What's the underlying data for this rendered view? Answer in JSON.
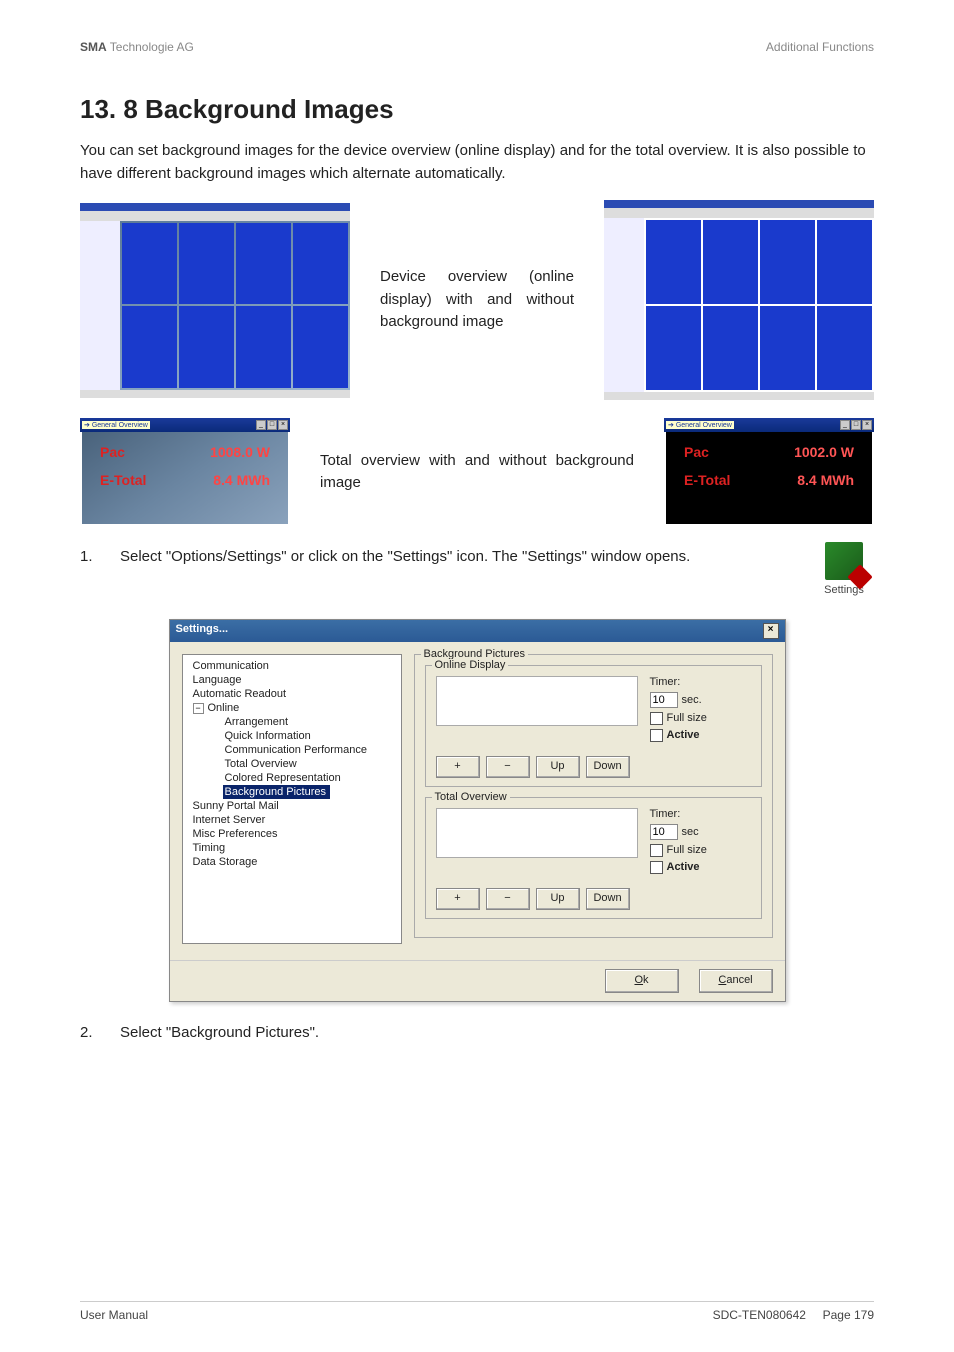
{
  "header": {
    "left_bold": "SMA",
    "left_rest": " Technologie AG",
    "right": "Additional Functions"
  },
  "title": "13. 8 Background Images",
  "intro": "You can set background images for the device overview (online display) and for the total overview. It is also possible to have different background images which alternate automatically.",
  "caption1": "Device overview (online display) with and without background image",
  "caption2": "Total overview with and without background image",
  "overview_window": {
    "title": "General Overview",
    "row1_key": "Pac",
    "row1_val_bg": "1008.0 W",
    "row1_val_nobg": "1002.0 W",
    "row2_key": "E-Total",
    "row2_val": "8.4 MWh"
  },
  "step1_num": "1.",
  "step1_text": "Select \"Options/Settings\" or click on the \"Settings\" icon. The \"Settings\" window opens.",
  "settings_icon_label": "Settings",
  "step2_num": "2.",
  "step2_text": "Select \"Background Pictures\".",
  "settings": {
    "title": "Settings...",
    "tree": {
      "n0": "Communication",
      "n1": "Language",
      "n2": "Automatic Readout",
      "n3": "Online",
      "n3a": "Arrangement",
      "n3b": "Quick Information",
      "n3c": "Communication Performance",
      "n3d": "Total Overview",
      "n3e": "Colored Representation",
      "n3f": "Background Pictures",
      "n4": "Sunny Portal Mail",
      "n5": "Internet Server",
      "n6": "Misc Preferences",
      "n7": "Timing",
      "n8": "Data Storage"
    },
    "group_main": "Background Pictures",
    "group_online": "Online Display",
    "group_total": "Total Overview",
    "btn_plus": "+",
    "btn_minus": "−",
    "btn_up": "Up",
    "btn_down": "Down",
    "timer_label": "Timer:",
    "timer_value_online": "10",
    "timer_unit_online": "sec.",
    "timer_value_total": "10",
    "timer_unit_total": "sec",
    "fullsize": "Full size",
    "active": "Active",
    "ok_u": "O",
    "ok_rest": "k",
    "cancel_u": "C",
    "cancel_rest": "ancel"
  },
  "footer": {
    "left": "User Manual",
    "mid": "SDC-TEN080642",
    "right": "Page 179"
  }
}
